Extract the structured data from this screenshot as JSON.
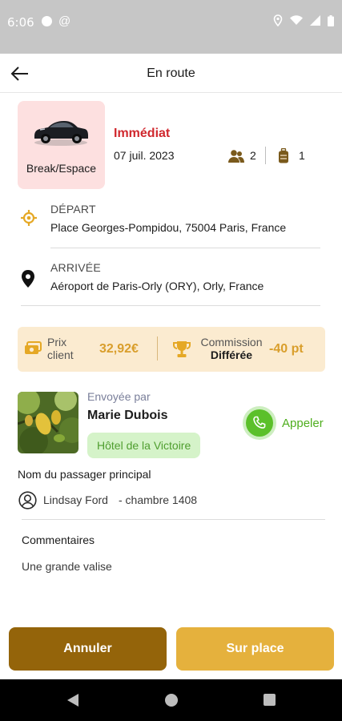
{
  "status_bar": {
    "time": "6:06"
  },
  "header": {
    "title": "En route"
  },
  "vehicle": {
    "type_label": "Break/Espace"
  },
  "trip": {
    "urgency": "Immédiat",
    "date": "07 juil. 2023",
    "passengers": "2",
    "luggage": "1"
  },
  "departure": {
    "title": "DÉPART",
    "address": "Place Georges-Pompidou, 75004 Paris, France"
  },
  "arrival": {
    "title": "ARRIVÉE",
    "address": "Aéroport de Paris-Orly (ORY), Orly, France"
  },
  "pricing": {
    "client_label": "Prix client",
    "client_price": "32,92€",
    "commission_label": "Commission",
    "commission_sub": "Différée",
    "commission_value": "-40 pt"
  },
  "sender": {
    "sent_by_label": "Envoyée par",
    "name": "Marie Dubois",
    "hotel": "Hôtel de la Victoire",
    "call_label": "Appeler"
  },
  "passenger": {
    "section_title": "Nom du passager principal",
    "name": "Lindsay Ford",
    "room": "- chambre 1408"
  },
  "comments": {
    "title": "Commentaires",
    "text": "Une grande valise"
  },
  "actions": {
    "cancel_label": "Annuler",
    "onsite_label": "Sur place"
  },
  "colors": {
    "accent": "#e5b13d",
    "cancel": "#94640a",
    "urgent": "#d0282e",
    "call_green": "#5bc02a"
  }
}
